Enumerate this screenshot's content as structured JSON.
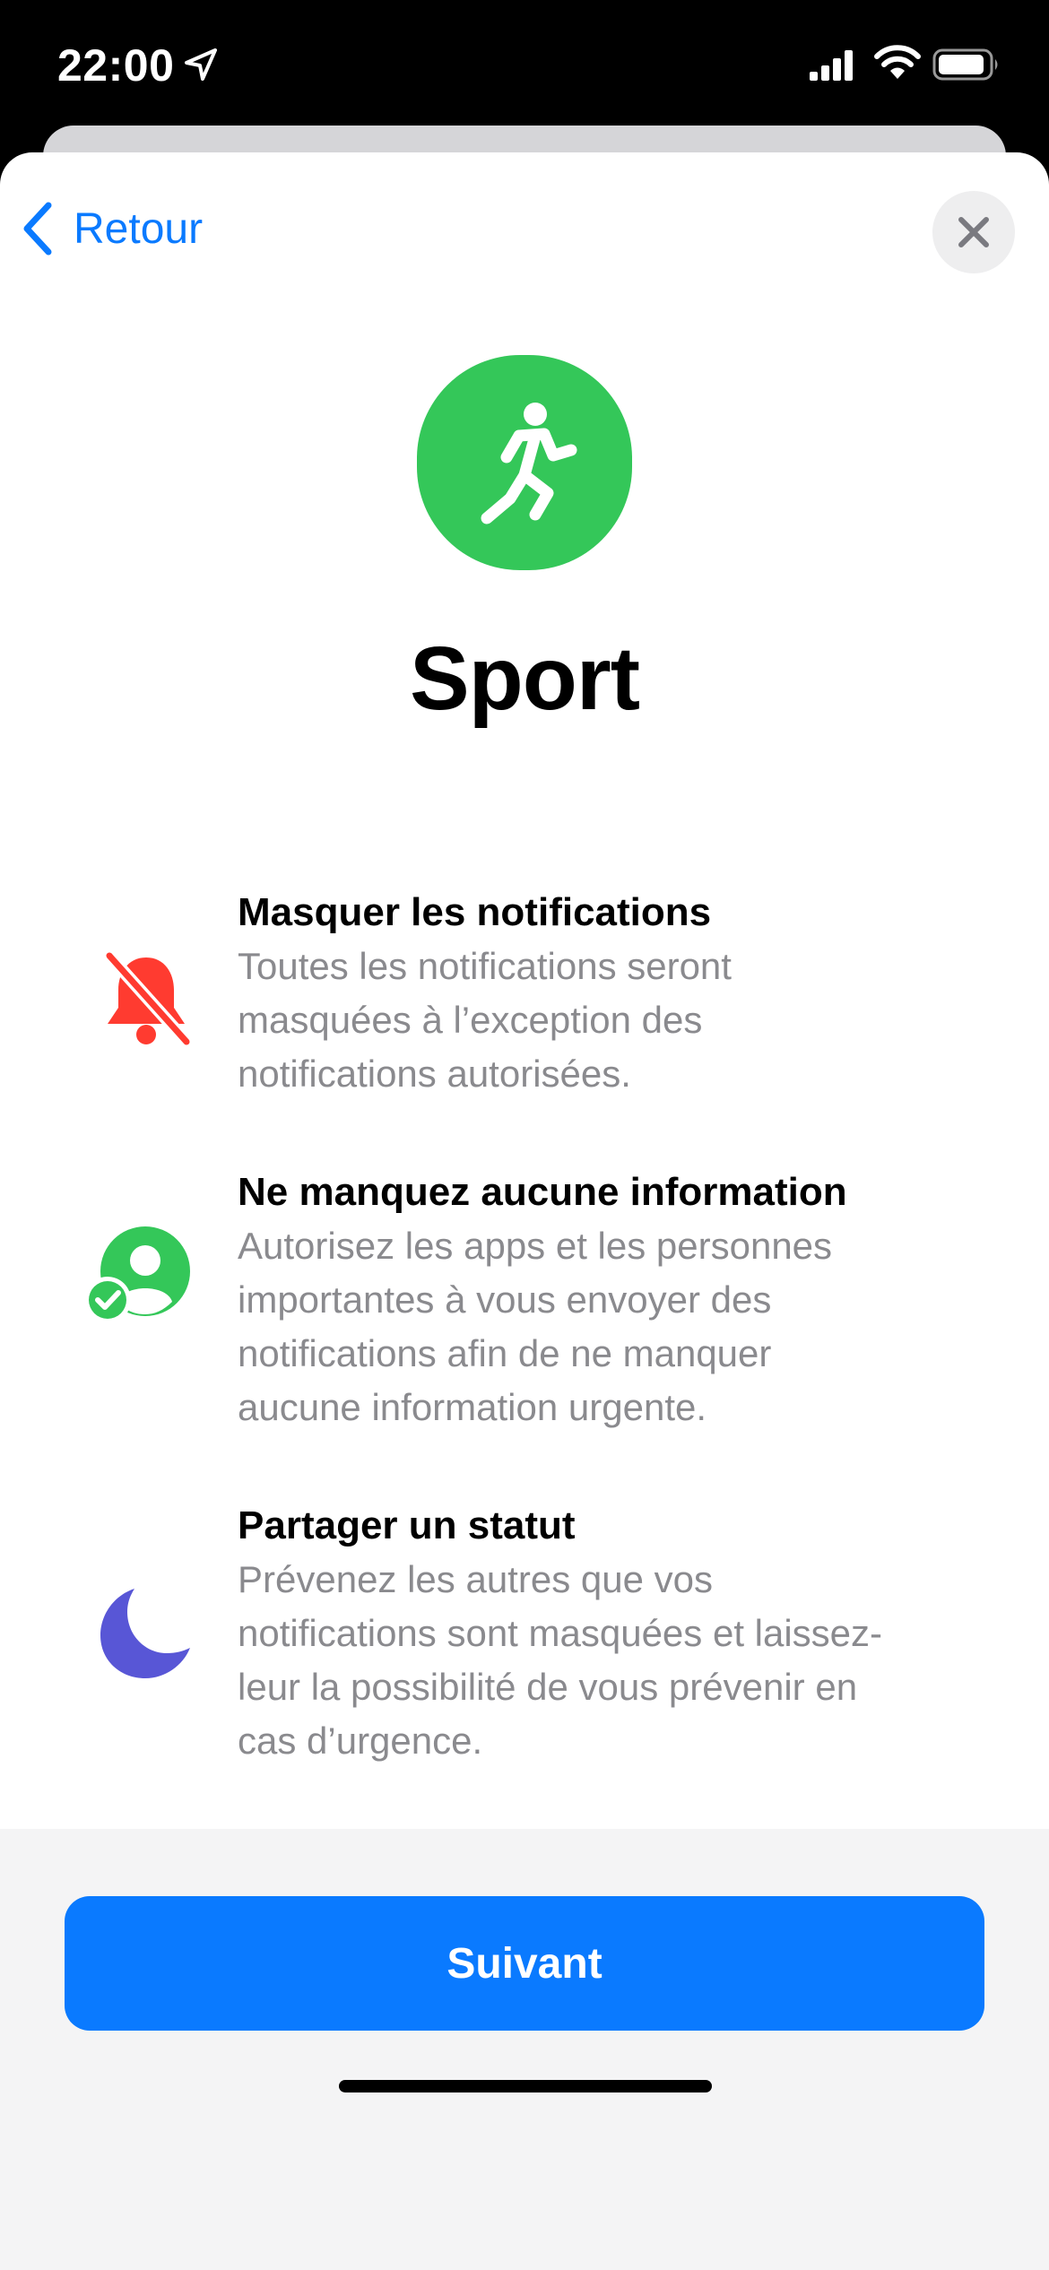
{
  "status_bar": {
    "time": "22:00"
  },
  "navigation": {
    "back_label": "Retour"
  },
  "focus": {
    "title": "Sport",
    "icon": "running-figure-icon",
    "accent_color": "#34c759"
  },
  "features": [
    {
      "icon": "bell-slash-icon",
      "title": "Masquer les notifications",
      "lines": [
        "Toutes les notifications seront",
        "masquées à l’exception des",
        "notifications autorisées."
      ]
    },
    {
      "icon": "person-checkmark-icon",
      "title": "Ne manquez aucune information",
      "lines": [
        "Autorisez les apps et les personnes",
        "importantes à vous envoyer des",
        "notifications afin de ne manquer",
        "aucune information urgente."
      ]
    },
    {
      "icon": "moon-icon",
      "title": "Partager un statut",
      "lines": [
        "Prévenez les autres que vos",
        "notifications sont masquées et laissez-",
        "leur la possibilité de vous prévenir en",
        "cas d’urgence."
      ]
    }
  ],
  "footer": {
    "next_label": "Suivant",
    "button_color": "#0a7aff"
  }
}
